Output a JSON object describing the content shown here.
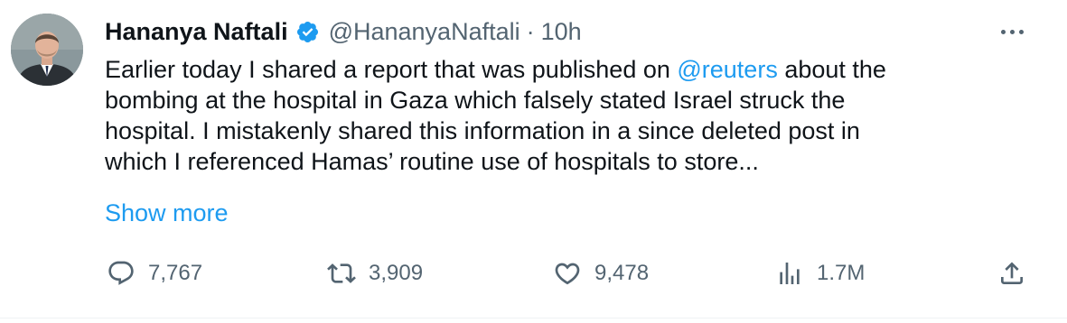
{
  "author": {
    "display_name": "Hananya Naftali",
    "handle": "@HananyaNaftali",
    "separator": "·",
    "time": "10h",
    "verified": true,
    "verified_color": "#1d9bf0"
  },
  "tweet": {
    "lines": [
      {
        "before": "Earlier today I shared a report that was published on ",
        "mention": "@reuters",
        "after": " about the"
      },
      {
        "text": "bombing at the hospital in Gaza which falsely stated Israel struck the"
      },
      {
        "text": "hospital. I mistakenly shared this information in a since deleted post in"
      },
      {
        "text": "which I referenced Hamas’ routine use of hospitals to store..."
      }
    ],
    "show_more": "Show more"
  },
  "actions": {
    "replies": "7,767",
    "retweets": "3,909",
    "likes": "9,478",
    "views": "1.7M"
  },
  "icons": {
    "more": "more-dots-icon",
    "reply": "reply-icon",
    "retweet": "retweet-icon",
    "like": "heart-icon",
    "views": "views-chart-icon",
    "share": "share-icon"
  },
  "colors": {
    "text": "#0f1419",
    "secondary": "#536471",
    "accent": "#1d9bf0"
  }
}
